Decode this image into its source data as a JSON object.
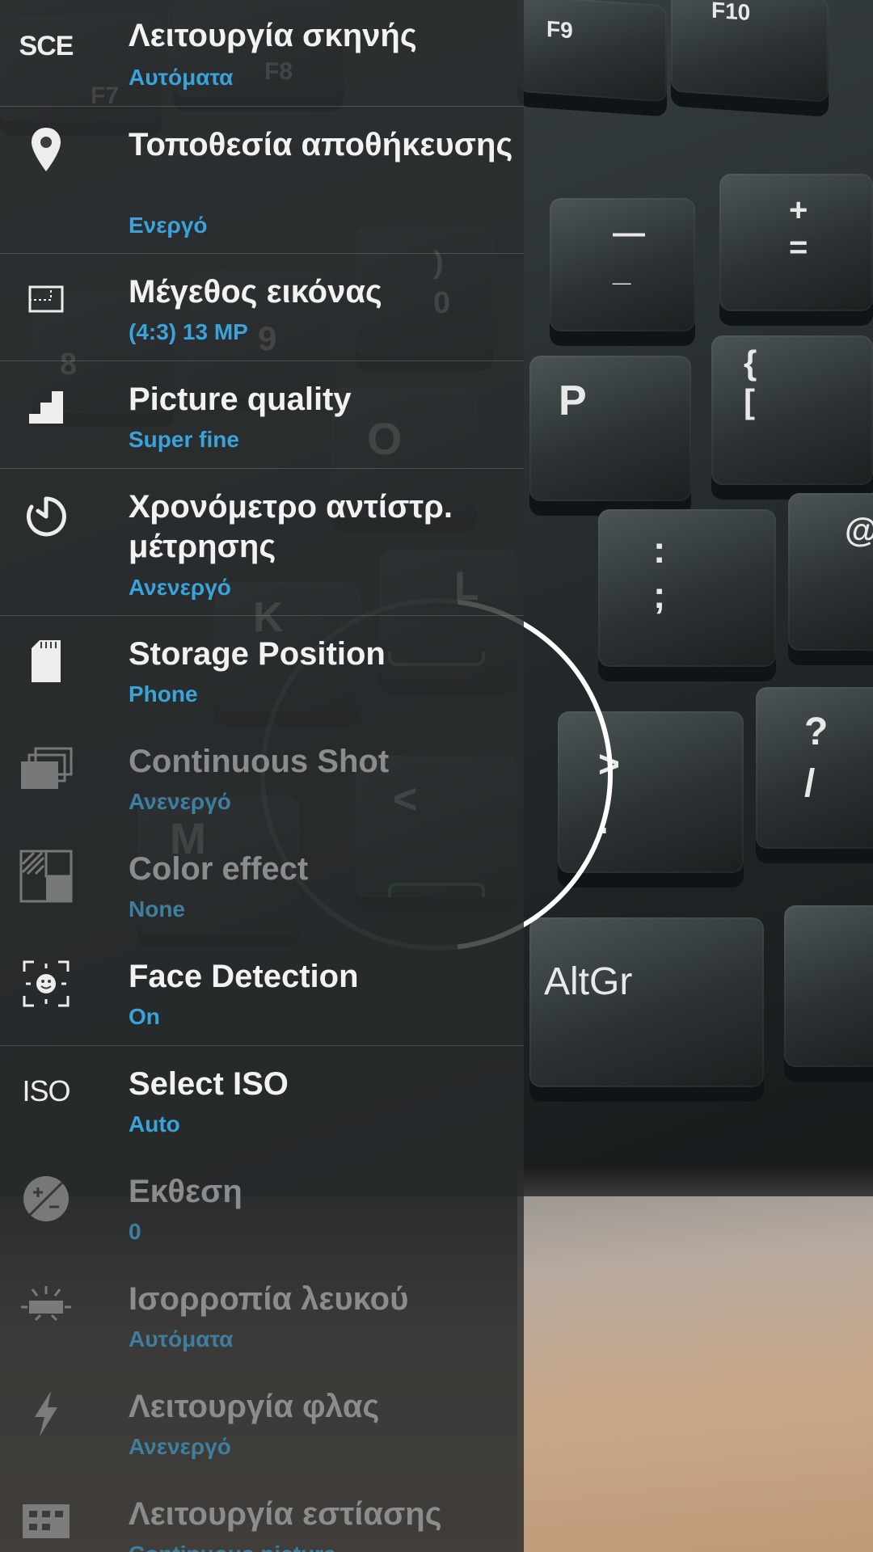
{
  "viewfinder": {
    "keys": [
      "F9",
      "F10",
      "F8",
      "F7",
      "—\n_",
      "+\n=",
      "P",
      "{\n[",
      ":\n;",
      "@",
      "?\n/",
      ">\n.",
      "<",
      "AltGr",
      "K",
      "L",
      "M",
      "O",
      ")\n0",
      "8",
      "9"
    ]
  },
  "settings": [
    {
      "id": "scene-mode",
      "icon": "scene-mode-icon",
      "icon_text": "SCE",
      "title": "Λειτουργία σκηνής",
      "value": "Αυτόματα",
      "enabled": true
    },
    {
      "id": "save-location",
      "icon": "location-pin-icon",
      "title": "Τοποθεσία αποθήκευσης",
      "value": "Ενεργό",
      "enabled": true
    },
    {
      "id": "image-size",
      "icon": "image-size-icon",
      "title": "Μέγεθος εικόνας",
      "value": "(4:3) 13 MP",
      "enabled": true
    },
    {
      "id": "picture-quality",
      "icon": "quality-steps-icon",
      "title": "Picture quality",
      "value": "Super fine",
      "enabled": true
    },
    {
      "id": "countdown-timer",
      "icon": "timer-icon",
      "title": "Χρονόμετρο αντίστρ. μέτρησης",
      "value": "Ανενεργό",
      "enabled": true
    },
    {
      "id": "storage-position",
      "icon": "sd-card-icon",
      "title": "Storage Position",
      "value": "Phone",
      "enabled": true
    },
    {
      "id": "continuous-shot",
      "icon": "continuous-shot-icon",
      "title": "Continuous Shot",
      "value": "Ανενεργό",
      "enabled": false
    },
    {
      "id": "color-effect",
      "icon": "color-effect-icon",
      "title": "Color effect",
      "value": "None",
      "enabled": false
    },
    {
      "id": "face-detection",
      "icon": "face-detection-icon",
      "title": "Face Detection",
      "value": "On",
      "enabled": true
    },
    {
      "id": "select-iso",
      "icon": "iso-icon",
      "icon_text": "ISO",
      "title": "Select ISO",
      "value": "Auto",
      "enabled": true
    },
    {
      "id": "exposure",
      "icon": "exposure-icon",
      "title": "Εκθεση",
      "value": "0",
      "enabled": false
    },
    {
      "id": "white-balance",
      "icon": "white-balance-icon",
      "title": "Ισορροπία λευκού",
      "value": "Αυτόματα",
      "enabled": false
    },
    {
      "id": "flash-mode",
      "icon": "flash-icon",
      "title": "Λειτουργία φλας",
      "value": "Ανενεργό",
      "enabled": false
    },
    {
      "id": "focus-mode",
      "icon": "focus-mode-icon",
      "title": "Λειτουργία εστίασης",
      "value": "Continuous picture",
      "enabled": false
    }
  ],
  "colors": {
    "value_accent": "#3aa3d9",
    "focus_ring": "#ffffff",
    "focus_bracket": "#2f8a3d"
  }
}
